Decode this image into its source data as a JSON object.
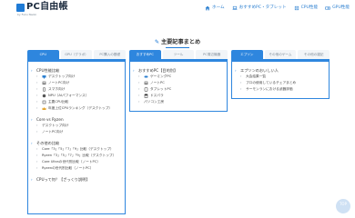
{
  "header": {
    "logo_text": "PC自由帳",
    "logo_sub": "by Fuku Naoki",
    "nav": [
      {
        "label": "ホーム",
        "icon": "home-icon"
      },
      {
        "label": "おすすめPC・タブレット",
        "icon": "laptop-icon"
      },
      {
        "label": "CPU性能",
        "icon": "cpu-icon"
      },
      {
        "label": "GPU性能",
        "icon": "gpu-icon"
      }
    ]
  },
  "page_title": "主要記事まとめ",
  "columns": [
    {
      "tabs": [
        "CPU",
        "GPU（グラボ）",
        "PC購入の基礎"
      ],
      "active_tab": 0,
      "sections": [
        {
          "head": "CPU性能比較",
          "items": [
            {
              "label": "デスクトップ向け",
              "icon": "desktop-icon"
            },
            {
              "label": "ノートPC向け",
              "icon": "laptop-icon"
            },
            {
              "label": "スマホ向け",
              "icon": "phone-icon"
            },
            {
              "label": "NPU（AIパフォーマンス）",
              "icon": "npu-icon"
            },
            {
              "label": "主要CPU比較",
              "icon": "compare-icon"
            },
            {
              "label": "年度上位CPUランキング（デスクトップ）",
              "icon": "crown-icon"
            }
          ]
        },
        {
          "head": "Core vs Ryzen",
          "items": [
            {
              "label": "デスクトップ向け",
              "icon": ""
            },
            {
              "label": "ノートPC向け",
              "icon": ""
            }
          ]
        },
        {
          "head": "その他の比較",
          "items": [
            {
              "label": "Core「3」「5」「7」「9」比較（デスクトップ）",
              "icon": ""
            },
            {
              "label": "Ryzen「3」「5」「7」「9」比較（デスクトップ）",
              "icon": ""
            },
            {
              "label": "Core Ultraの世代別比較（ノートPC）",
              "icon": ""
            },
            {
              "label": "Ryzenの世代別比較（ノートPC）",
              "icon": ""
            }
          ]
        },
        {
          "head": "CPUって何？【ざっくり説明】",
          "items": []
        }
      ]
    },
    {
      "tabs": [
        "おすすめPC",
        "ツール",
        "PC周辺機器"
      ],
      "active_tab": 0,
      "sections": [
        {
          "head": "おすすめPC【目的別】",
          "items": [
            {
              "label": "ゲーミングPC",
              "icon": "gamepad-icon"
            },
            {
              "label": "ノートPC",
              "icon": "laptop-icon"
            },
            {
              "label": "タブレットPC",
              "icon": "tablet-icon"
            },
            {
              "label": "ドスパラ",
              "icon": "store-icon"
            },
            {
              "label": "パソコン工房",
              "icon": ""
            }
          ]
        }
      ]
    },
    {
      "tabs": [
        "エプソン",
        "その他のゲーム",
        "その他の雑記"
      ],
      "active_tab": 0,
      "sections": [
        {
          "head": "エプソンのおいしい人",
          "items": [
            {
              "label": "大会結果一覧",
              "icon": ""
            },
            {
              "label": "プロの使用しているチェアまとめ",
              "icon": ""
            },
            {
              "label": "サーモンランにおける武器評価",
              "icon": ""
            }
          ]
        }
      ]
    }
  ],
  "scroll_top_label": "TOP",
  "colors": {
    "accent": "#2e86de",
    "brand": "#1f7bd6",
    "tab_bg": "#f2f5f8"
  }
}
